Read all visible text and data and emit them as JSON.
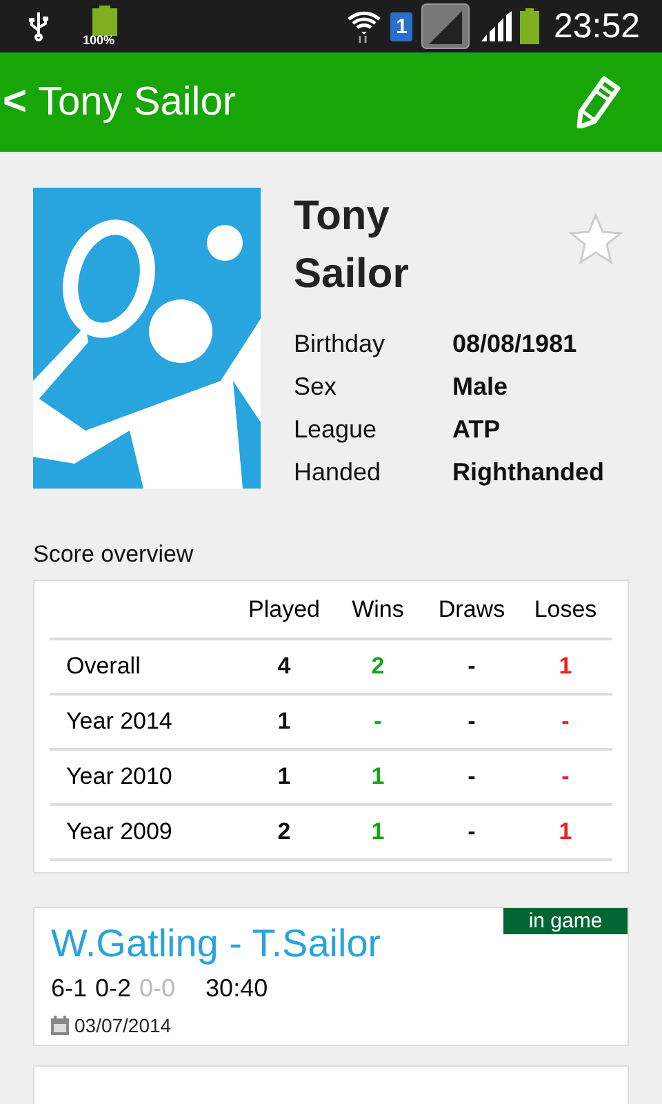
{
  "status_bar": {
    "battery_label": "100%",
    "sim": "1",
    "time": "23:52"
  },
  "app_bar": {
    "back": "<",
    "title": "Tony Sailor"
  },
  "player": {
    "name": "Tony Sailor",
    "favorite": false,
    "details": [
      {
        "label": "Birthday",
        "value": "08/08/1981"
      },
      {
        "label": "Sex",
        "value": "Male"
      },
      {
        "label": "League",
        "value": "ATP"
      },
      {
        "label": "Handed",
        "value": "Righthanded"
      }
    ]
  },
  "score_overview": {
    "title": "Score overview",
    "columns": [
      {
        "label": "Played",
        "kind": "count"
      },
      {
        "label": "Wins",
        "kind": "win"
      },
      {
        "label": "Draws",
        "kind": "draw"
      },
      {
        "label": "Loses",
        "kind": "loss"
      }
    ],
    "rows": [
      {
        "label": "Overall",
        "values": [
          "4",
          "2",
          "-",
          "1"
        ]
      },
      {
        "label": "Year 2014",
        "values": [
          "1",
          "-",
          "-",
          "-"
        ]
      },
      {
        "label": "Year 2010",
        "values": [
          "1",
          "1",
          "-",
          "-"
        ]
      },
      {
        "label": "Year 2009",
        "values": [
          "2",
          "1",
          "-",
          "1"
        ]
      }
    ]
  },
  "matches": [
    {
      "title": "W.Gatling - T.Sailor",
      "status": "in game",
      "sets": [
        {
          "score": "6-1",
          "current": false
        },
        {
          "score": "0-2",
          "current": false
        },
        {
          "score": "0-0",
          "current": true
        }
      ],
      "game": "30:40",
      "date": "03/07/2014"
    }
  ]
}
